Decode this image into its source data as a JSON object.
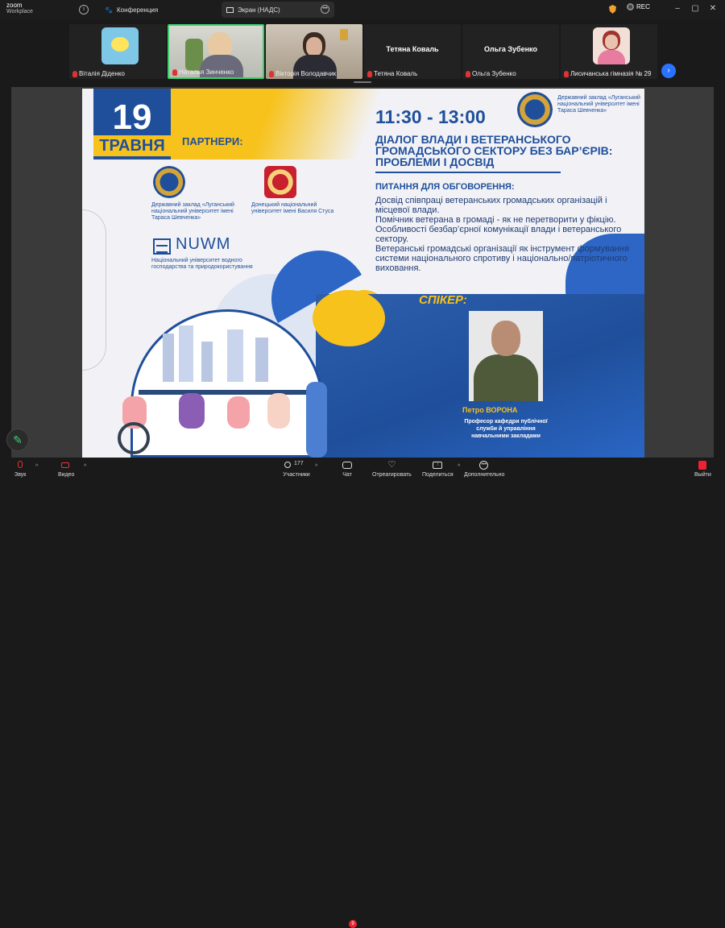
{
  "app": {
    "logo_line1": "zoom",
    "logo_line2": "Workplace"
  },
  "tabs": {
    "conference": "Конференция",
    "screen": "Экран (НАДС)"
  },
  "status": {
    "rec": "REC"
  },
  "participants": [
    {
      "name": "Віталія Діденко",
      "muted": true
    },
    {
      "name": "Наталья Зинченко",
      "muted": true,
      "active": true
    },
    {
      "name": "Вікторія Володавчик",
      "muted": true
    },
    {
      "name": "Тетяна Коваль",
      "display": "Тетяна Коваль",
      "muted": true
    },
    {
      "name": "Ольга  Зубенко",
      "display": "Ольга  Зубенко",
      "muted": true
    },
    {
      "name": "Лисичанська гімназія № 29",
      "muted": true
    }
  ],
  "slide": {
    "day": "19",
    "month": "ТРАВНЯ",
    "partners_title": "ПАРТНЕРИ:",
    "partner1": "Державний заклад «Луганський національний університет імені Тараса Шевченка»",
    "partner2": "Донецький національний університет імені Василя Стуса",
    "partner3_logo": "NUWM",
    "partner3": "Національний університет водного господарства та природокористування",
    "time": "11:30 - 13:00",
    "header_org": "Державний заклад «Луганський національний університет імені Тараса Шевченка»",
    "title": "ДІАЛОГ ВЛАДИ І ВЕТЕРАНСЬКОГО ГРОМАДСЬКОГО СЕКТОРУ БЕЗ БАР’ЄРІВ: ПРОБЛЕМИ І ДОСВІД",
    "topics_title": "ПИТАННЯ ДЛЯ ОБГОВОРЕННЯ:",
    "topics": [
      "Досвід співпраці ветеранських громадських організацій і місцевої влади.",
      "Помічник ветерана в громаді - як не перетворити у фікцію.",
      "Особливості безбар’єрної комунікації влади і ветеранського сектору.",
      "Ветеранські громадські організації як інструмент формування системи національного спротиву і національно/патріотичного виховання."
    ],
    "speaker_title": "СПІКЕР:",
    "speaker_name": "Петро ВОРОНА",
    "speaker_role": "Професор кафедри публічної служби й управління навчальними закладами"
  },
  "toolbar": {
    "audio": "Звук",
    "video": "Видео",
    "participants": "Участники",
    "participants_count": "177",
    "chat": "Чат",
    "chat_badge": "9",
    "react": "Отреагировать",
    "share": "Поделиться",
    "more": "Дополнительно",
    "leave": "Выйти"
  },
  "colors": {
    "brand_blue": "#1f4f9b",
    "brand_yellow": "#f7c21b",
    "zoom_blue": "#2a72ff",
    "active_green": "#3ecf6f"
  }
}
